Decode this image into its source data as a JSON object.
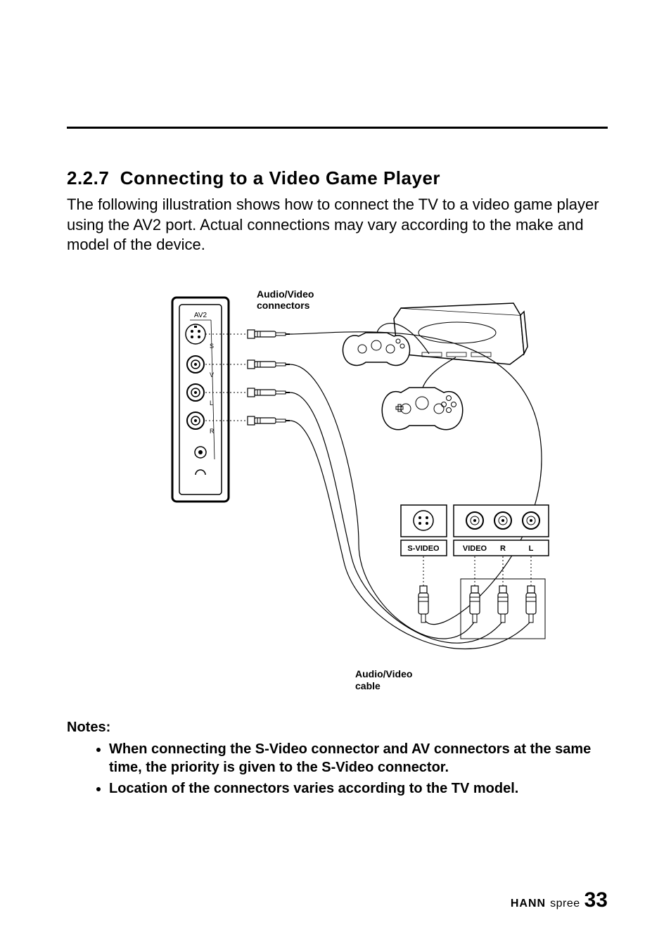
{
  "section": {
    "number": "2.2.7",
    "title": "Connecting to a Video Game Player",
    "intro": "The following illustration shows how to connect the TV to a video game player using the AV2 port. Actual connections may vary according to the make and model of the device."
  },
  "diagram": {
    "panel_label": "AV2",
    "port_labels": {
      "s": "S",
      "v": "V",
      "l": "L",
      "r": "R"
    },
    "callout_connectors": "Audio/Video connectors",
    "callout_cable": "Audio/Video cable",
    "device_ports": {
      "svideo": "S-VIDEO",
      "video": "VIDEO",
      "r": "R",
      "l": "L"
    }
  },
  "notes": {
    "heading": "Notes:",
    "items": [
      "When connecting the S-Video connector and AV connectors at the same time, the priority is given to the S-Video connector.",
      "Location of the connectors varies according to the TV model."
    ]
  },
  "footer": {
    "brand_strong": "HANN",
    "brand_light": "spree",
    "page": "33"
  }
}
